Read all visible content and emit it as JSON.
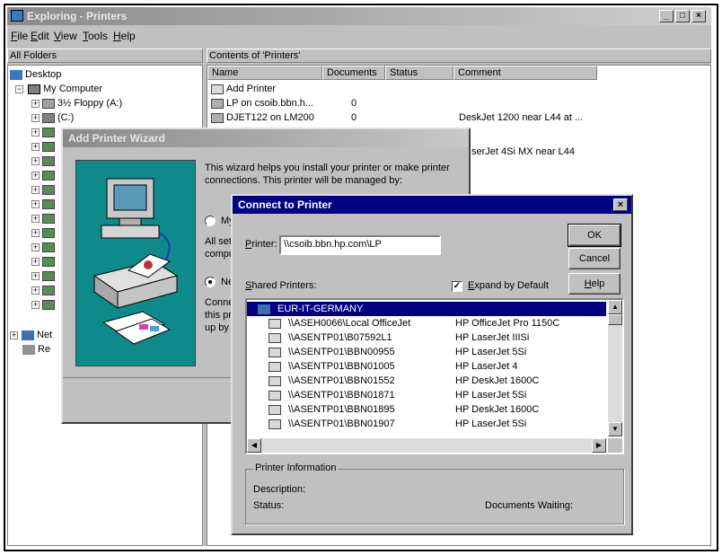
{
  "explorer": {
    "title": "Exploring - Printers",
    "menu": [
      "File",
      "Edit",
      "View",
      "Tools",
      "Help"
    ],
    "left_header": "All Folders",
    "right_header": "Contents of 'Printers'",
    "tree": [
      "Desktop",
      "My Computer",
      "3½ Floppy (A:)",
      "(C:)",
      "Net",
      "Re"
    ],
    "columns": [
      "Name",
      "Documents",
      "Status",
      "Comment"
    ],
    "rows": [
      {
        "name": "Add Printer",
        "docs": "",
        "comment": ""
      },
      {
        "name": "LP on csoib.bbn.h...",
        "docs": "0",
        "comment": ""
      },
      {
        "name": "DJET122 on LM200",
        "docs": "0",
        "comment": "DeskJet 1200 near L44 at ..."
      }
    ],
    "partial_comment": "serJet 4Si MX near L44"
  },
  "wizard": {
    "title": "Add Printer Wizard",
    "intro": "This wizard helps you install your printer or make printer connections.  This printer will be managed by:",
    "option1_fragment": "My",
    "body_fragment_1": "All setti",
    "body_fragment_2": "compu",
    "option2_fragment": "Ne",
    "body_fragment_3": "Conne",
    "body_fragment_4": "this prin",
    "body_fragment_5": "up by a"
  },
  "dialog": {
    "title": "Connect to Printer",
    "printer_label": "Printer:",
    "printer_value": "\\\\csoib.bbn.hp.com\\LP",
    "ok": "OK",
    "cancel": "Cancel",
    "help": "Help",
    "shared_label": "Shared Printers:",
    "expand_label": "Expand by Default",
    "expand_checked": true,
    "group": "EUR-IT-GERMANY",
    "printers": [
      {
        "path": "\\\\ASEH0066\\Local OfficeJet",
        "model": "HP OfficeJet Pro 1150C"
      },
      {
        "path": "\\\\ASENTP01\\B07592L1",
        "model": "HP LaserJet IIISi"
      },
      {
        "path": "\\\\ASENTP01\\BBN00955",
        "model": "HP LaserJet 5Si"
      },
      {
        "path": "\\\\ASENTP01\\BBN01005",
        "model": "HP LaserJet 4"
      },
      {
        "path": "\\\\ASENTP01\\BBN01552",
        "model": "HP DeskJet 1600C"
      },
      {
        "path": "\\\\ASENTP01\\BBN01871",
        "model": "HP LaserJet 5Si"
      },
      {
        "path": "\\\\ASENTP01\\BBN01895",
        "model": "HP DeskJet 1600C"
      },
      {
        "path": "\\\\ASENTP01\\BBN01907",
        "model": "HP LaserJet 5Si"
      }
    ],
    "info_title": "Printer Information",
    "description_label": "Description:",
    "status_label": "Status:",
    "docs_waiting_label": "Documents Waiting:"
  },
  "icons": {
    "printer": "printer-icon",
    "computer": "computer-icon",
    "drive": "drive-icon",
    "network": "network-icon",
    "recycle": "recycle-bin-icon"
  }
}
